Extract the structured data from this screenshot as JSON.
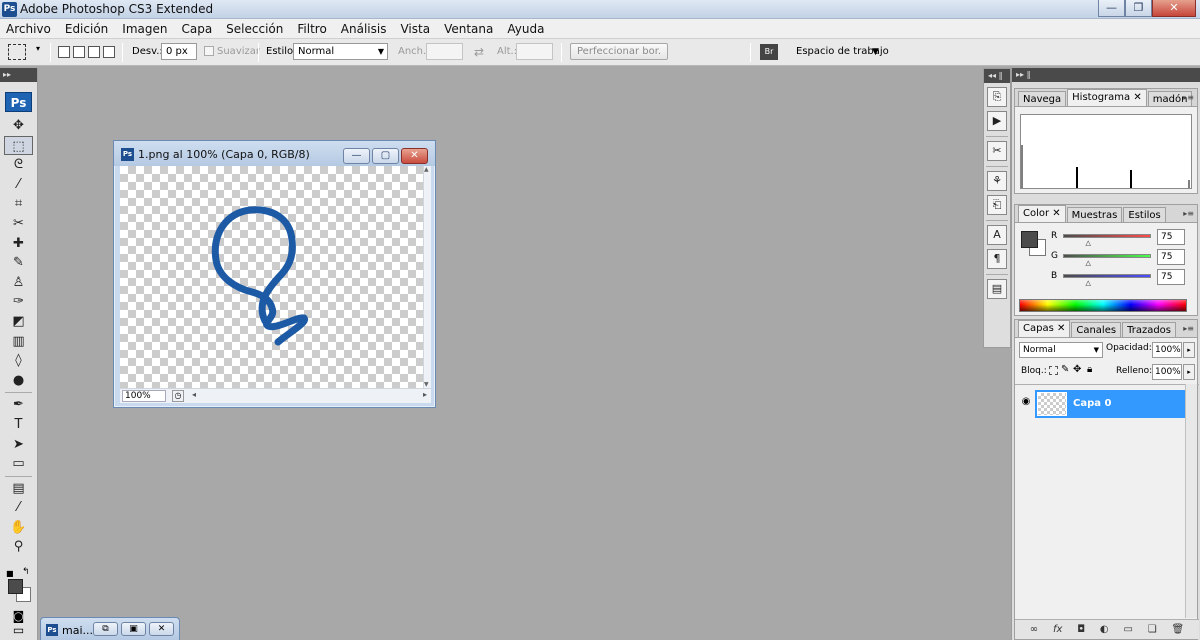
{
  "window": {
    "title": "Adobe Photoshop CS3 Extended",
    "logo": "Ps",
    "minimize": "—",
    "restore": "❐",
    "close": "✕"
  },
  "menu": [
    "Archivo",
    "Edición",
    "Imagen",
    "Capa",
    "Selección",
    "Filtro",
    "Análisis",
    "Vista",
    "Ventana",
    "Ayuda"
  ],
  "options": {
    "feather_label": "Desv.:",
    "feather_value": "0 px",
    "antialias_label": "Suavizar",
    "style_label": "Estilo:",
    "style_value": "Normal",
    "width_label": "Anch.:",
    "height_label": "Alt.:",
    "refine_button": "Perfeccionar bor.",
    "workspace_label": "Espacio de trabajo",
    "swap_symbol": "⇄"
  },
  "toolbox": {
    "logo": "Ps",
    "tools": [
      {
        "name": "move-tool-icon",
        "glyph": "✥"
      },
      {
        "name": "marquee-tool-icon",
        "glyph": "⬚",
        "active": true
      },
      {
        "name": "lasso-tool-icon",
        "glyph": "ᘓ"
      },
      {
        "name": "quick-selection-tool-icon",
        "glyph": "⁄"
      },
      {
        "name": "crop-tool-icon",
        "glyph": "⌗"
      },
      {
        "name": "slice-tool-icon",
        "glyph": "✂"
      },
      {
        "name": "healing-brush-tool-icon",
        "glyph": "✚"
      },
      {
        "name": "brush-tool-icon",
        "glyph": "✎"
      },
      {
        "name": "clone-stamp-tool-icon",
        "glyph": "♙"
      },
      {
        "name": "history-brush-tool-icon",
        "glyph": "✑"
      },
      {
        "name": "eraser-tool-icon",
        "glyph": "◩"
      },
      {
        "name": "gradient-tool-icon",
        "glyph": "▥"
      },
      {
        "name": "blur-tool-icon",
        "glyph": "◊"
      },
      {
        "name": "dodge-tool-icon",
        "glyph": "●"
      },
      {
        "name": "pen-tool-icon",
        "glyph": "✒"
      },
      {
        "name": "type-tool-icon",
        "glyph": "T"
      },
      {
        "name": "path-selection-tool-icon",
        "glyph": "➤"
      },
      {
        "name": "shape-tool-icon",
        "glyph": "▭"
      },
      {
        "name": "notes-tool-icon",
        "glyph": "▤"
      },
      {
        "name": "eyedropper-tool-icon",
        "glyph": "⁄"
      },
      {
        "name": "hand-tool-icon",
        "glyph": "✋"
      },
      {
        "name": "zoom-tool-icon",
        "glyph": "⚲"
      }
    ]
  },
  "document": {
    "title": "1.png al 100% (Capa 0, RGB/8)",
    "icon": "Ps",
    "zoom": "100%",
    "stroke_color": "#1d5aa6"
  },
  "minimized_doc": {
    "label": "mai...",
    "icon": "Ps"
  },
  "panels": {
    "histogram": {
      "tabs": [
        "Navega",
        "Histograma",
        "madón"
      ],
      "active_tab": 1
    },
    "color": {
      "tabs": [
        "Color",
        "Muestras",
        "Estilos"
      ],
      "active_tab": 0,
      "channels": [
        {
          "label": "R",
          "value": "75",
          "fraction": 0.29,
          "track": "linear-gradient(to right, #4b4b4b, #ff4b4b)"
        },
        {
          "label": "G",
          "value": "75",
          "fraction": 0.29,
          "track": "linear-gradient(to right, #4b4b4b, #4bff4b)"
        },
        {
          "label": "B",
          "value": "75",
          "fraction": 0.29,
          "track": "linear-gradient(to right, #4b4b4b, #4b4bff)"
        }
      ],
      "foreground": "#4b4b4b",
      "background": "#ffffff"
    },
    "layers": {
      "tabs": [
        "Capas",
        "Canales",
        "Trazados"
      ],
      "active_tab": 0,
      "blend_mode": "Normal",
      "opacity_label": "Opacidad:",
      "opacity_value": "100%",
      "lock_label": "Bloq.:",
      "fill_label": "Relleno:",
      "fill_value": "100%",
      "layer_name": "Capa 0",
      "selection_color": "#3399ff"
    }
  }
}
